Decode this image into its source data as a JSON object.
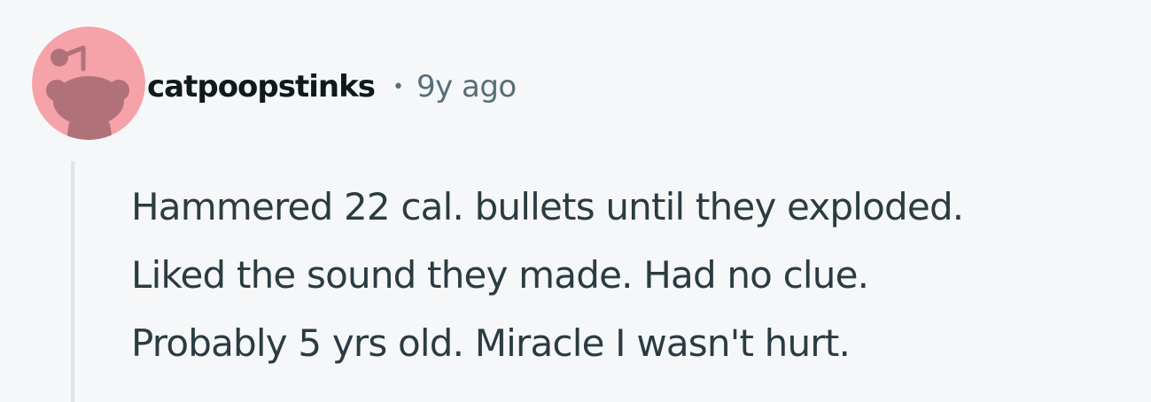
{
  "comment": {
    "author": "catpoopstinks",
    "separator": "•",
    "timestamp": "9y ago",
    "avatar_icon": "snoo-avatar-icon",
    "avatar_bg_color": "#f5a3a8",
    "avatar_fg_color": "#b07278",
    "body_lines": [
      "Hammered 22 cal. bullets until they exploded.",
      "Liked the sound they made. Had no clue.",
      "Probably 5 yrs old. Miracle I wasn't hurt."
    ]
  }
}
